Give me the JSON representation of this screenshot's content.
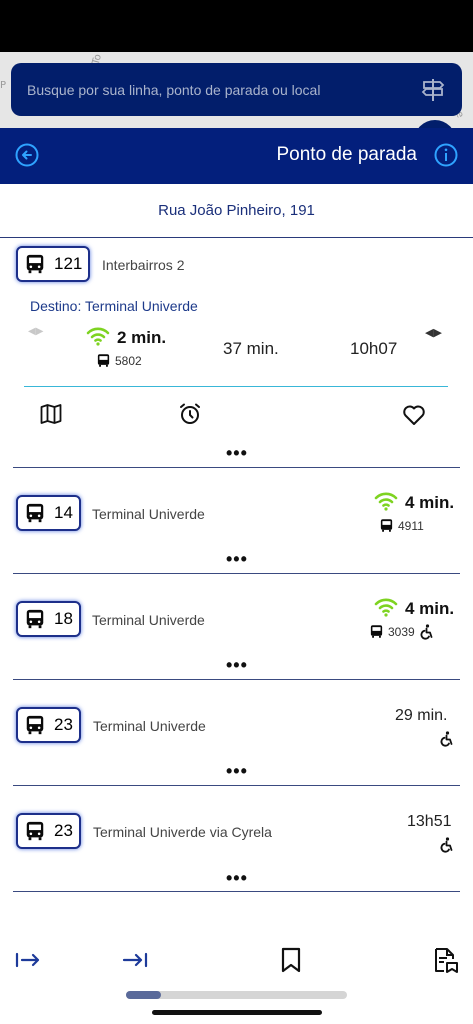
{
  "search": {
    "placeholder": "Busque por sua linha, ponto de parada ou local"
  },
  "header": {
    "title": "Ponto de parada"
  },
  "stop": {
    "address": "Rua João Pinheiro, 191"
  },
  "expanded": {
    "line": "121",
    "name": "Interbairros 2",
    "destination": "Destino: Terminal Univerde",
    "arrivals": [
      {
        "time": "2 min.",
        "vehicle": "5802"
      },
      {
        "time": "37 min."
      },
      {
        "time": "10h07"
      }
    ]
  },
  "lines": [
    {
      "line": "14",
      "name": "Terminal Univerde",
      "time": "4 min.",
      "vehicle": "4911",
      "realtime": true,
      "accessible": false
    },
    {
      "line": "18",
      "name": "Terminal Univerde",
      "time": "4 min.",
      "vehicle": "3039",
      "realtime": true,
      "accessible": true
    },
    {
      "line": "23",
      "name": "Terminal Univerde",
      "time": "29 min.",
      "realtime": false,
      "accessible": true
    },
    {
      "line": "23",
      "name": "Terminal Univerde via Cyrela",
      "time": "13h51",
      "realtime": false,
      "accessible": true
    }
  ],
  "more": "•••",
  "colors": {
    "primary": "#031f7c",
    "realtime": "#7ed321"
  }
}
